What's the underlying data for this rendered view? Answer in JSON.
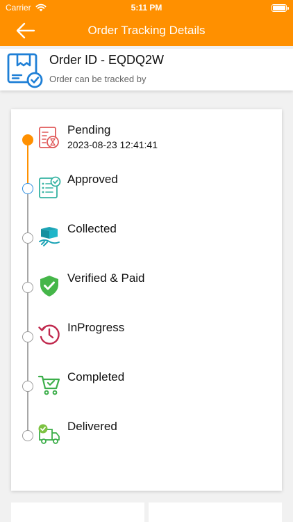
{
  "status_bar": {
    "carrier": "Carrier",
    "time": "5:11 PM"
  },
  "nav": {
    "title": "Order Tracking Details"
  },
  "order": {
    "id_text": "Order ID - EQDQ2W",
    "subtitle": "Order can be tracked by"
  },
  "timeline": {
    "steps": [
      {
        "label": "Pending",
        "timestamp": "2023-08-23 12:41:41",
        "state": "done",
        "icon": "pending-doc-icon"
      },
      {
        "label": "Approved",
        "state": "current",
        "icon": "approved-checklist-icon"
      },
      {
        "label": "Collected",
        "state": "upcoming",
        "icon": "collected-box-icon"
      },
      {
        "label": "Verified & Paid",
        "state": "upcoming",
        "icon": "verified-shield-icon"
      },
      {
        "label": "InProgress",
        "state": "upcoming",
        "icon": "in-progress-clock-icon"
      },
      {
        "label": "Completed",
        "state": "upcoming",
        "icon": "completed-cart-icon"
      },
      {
        "label": "Delivered",
        "state": "upcoming",
        "icon": "delivered-truck-icon"
      }
    ]
  },
  "colors": {
    "brand": "#ff9000",
    "current_step": "#2b8de0",
    "upcoming_step": "#9a9a9a"
  }
}
